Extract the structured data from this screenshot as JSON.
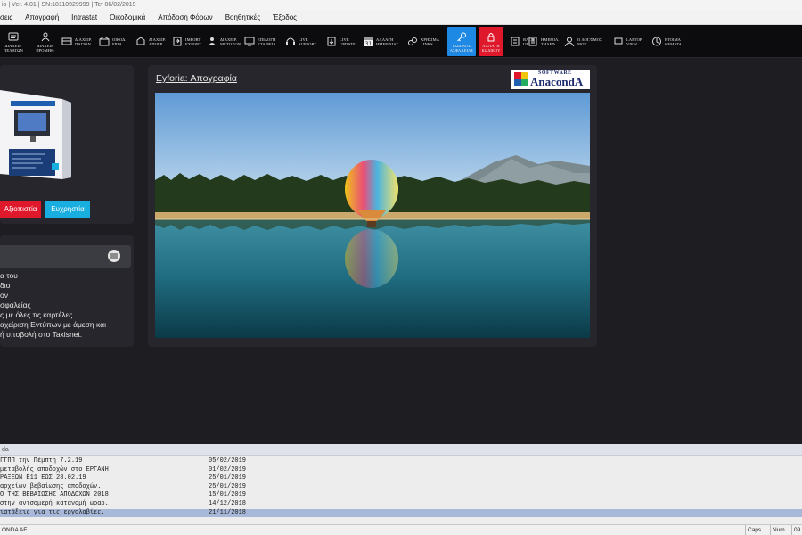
{
  "window": {
    "title": "io | Ver. 4.01 | SN:18110929999 | Τετ 06/02/2019"
  },
  "menu": [
    "σεις",
    "Απογραφή",
    "Intrastat",
    "Οικοδομικά",
    "Απόδοση Φόρων",
    "Βοηθητικές",
    "Έξοδος"
  ],
  "toolbar": [
    {
      "label": "ΔΙΑΧΕΙΡ.\nΠΕΛΑΤΩΝ",
      "icon": "customers-icon"
    },
    {
      "label": "ΔΙΑΧΕΙΡ.\nΠΡΟΜΗΘ.",
      "icon": "suppliers-icon"
    },
    {
      "label": "ΔΙΑΧΕΙΡ.\nΠΑΓΙΩΝ",
      "icon": "fixed-assets-icon"
    },
    {
      "label": "ΟΙΚΟΔ.\nΕΡΓΑ",
      "icon": "construction-icon"
    },
    {
      "label": "ΔΙΑΧΕΙΡ.\nΑΠΟΓΡ.",
      "icon": "inventory-icon"
    },
    {
      "label": "IMPORT\nEXPORT",
      "icon": "import-export-icon"
    },
    {
      "label": "ΔΙΑΧΕΙΡ.\nΜΕΤΟΧΩΝ",
      "icon": "shares-icon"
    },
    {
      "label": "ΕΠΙΛΟΓΗ\nΕΤΑΙΡΕΙΑ",
      "icon": "company-icon"
    },
    {
      "label": "LIVE\nSUPPORT",
      "icon": "headset-icon"
    },
    {
      "label": "LIVE\nUPDATE",
      "icon": "update-icon"
    },
    {
      "label": "ΑΛΛΑΓΗ\nΗΜΕΡ/ΝΙΑΣ",
      "icon": "calendar-icon"
    },
    {
      "label": "ΧΡΗΣΙΜΑ\nLINKS",
      "icon": "links-icon"
    },
    {
      "label": "ΚΩΔΙΚΟΣ\nΑΣΦΑΛΕΙΑΣ",
      "icon": "key-icon"
    },
    {
      "label": "ΑΛΛΑΓΗ\nΚΩΔΙΚΟΥ",
      "icon": "lock-icon"
    },
    {
      "label": "BACK\nUP",
      "icon": "backup-icon"
    },
    {
      "label": "ΗΜΕΡΟΛ.\nΤΗΛΕΦ.",
      "icon": "phone-log-icon"
    },
    {
      "label": "Ο ΛΟΓ/ΣΜΟΣ\nΜΟΥ",
      "icon": "user-icon"
    },
    {
      "label": "LAPTOP\nVIEW",
      "icon": "laptop-icon"
    },
    {
      "label": "ΕΤΟΙΜΑ\nΘΕΜΑΤΑ",
      "icon": "topics-icon"
    }
  ],
  "promo": {
    "reliability_label": "Αξιοπιστία",
    "ease_label": "Ευχρηστία"
  },
  "info_lines": [
    "α του",
    "διο",
    "ον",
    "σφαλείας",
    "ς με όλες τις καρτέλες",
    "αχείριση Εντύπων με άμεση και",
    "ή υποβολή στο Taxisnet."
  ],
  "feature": {
    "title": "Eyforia: Απογραφία",
    "logo_top": "SOFTWARE",
    "logo_main": "AnacondA"
  },
  "news": {
    "header": "da",
    "items": [
      {
        "text": "ΓΓΠΠ την Πέμπτη 7.2.19",
        "date": "05/02/2019"
      },
      {
        "text": " μεταβολής αποδοχών στο ΕΡΓΑΝΗ",
        "date": "01/02/2019"
      },
      {
        "text": "ΡΑΞΕΩΝ Ε11 ΕΩΣ 28.02.19",
        "date": "25/01/2019"
      },
      {
        "text": "αρχείων βεβαίωσης αποδοχών.",
        "date": "25/01/2019"
      },
      {
        "text": "Ο ΤΗΣ ΒΕΒΑΙΩΣΗΣ ΑΠΟΔΟΧΩΝ 2018",
        "date": "15/01/2019"
      },
      {
        "text": " στην ανισομερή κατανομή ωραρ.",
        "date": "14/12/2018"
      },
      {
        "text": "ιατάξεις για τις εργολαβίες.",
        "date": "21/11/2018"
      }
    ]
  },
  "status": {
    "company": "ONDA AE",
    "caps": "Caps",
    "num": "Num",
    "extra": "09"
  },
  "colors": {
    "accent_blue": "#1e88e5",
    "accent_red": "#e0182b",
    "cyan": "#18aee0"
  }
}
